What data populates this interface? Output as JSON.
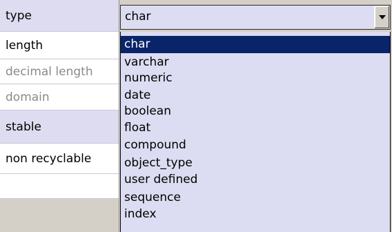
{
  "properties": [
    {
      "label": "type",
      "enabled": true
    },
    {
      "label": "length",
      "enabled": true
    },
    {
      "label": "decimal length",
      "enabled": false
    },
    {
      "label": "domain",
      "enabled": false
    },
    {
      "label": "stable",
      "enabled": true
    },
    {
      "label": "non recyclable",
      "enabled": true
    }
  ],
  "combo": {
    "value": "char",
    "arrow_icon": "chevron-down-icon"
  },
  "dropdown": {
    "selected_index": 0,
    "options": [
      "char",
      "varchar",
      "numeric",
      "date",
      "boolean",
      "float",
      "compound",
      "object_type",
      "user defined",
      "sequence",
      "index"
    ]
  },
  "colors": {
    "selection": "#0a246a",
    "list_background": "#dcdcf2",
    "window_background": "#d4d0c8"
  }
}
